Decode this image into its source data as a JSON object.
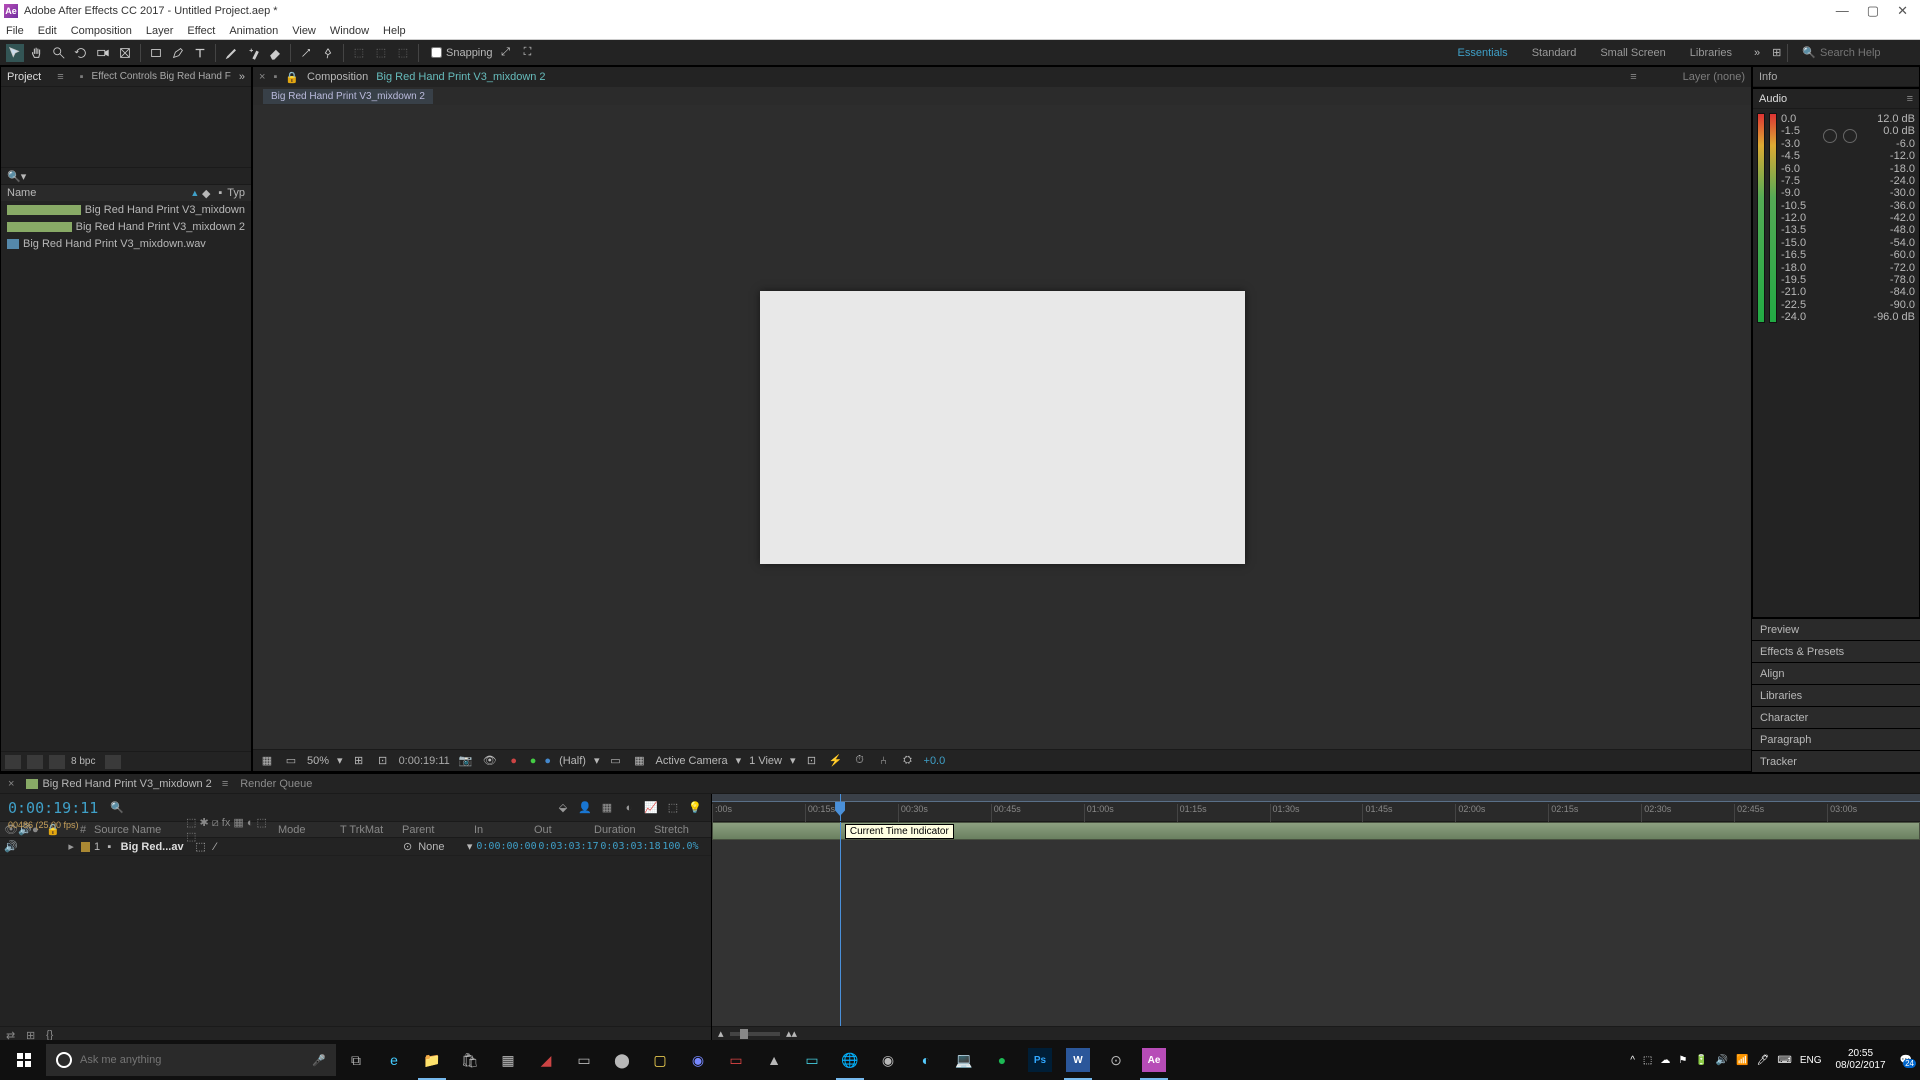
{
  "titlebar": {
    "app": "Ae",
    "title": "Adobe After Effects CC 2017 - Untitled Project.aep *"
  },
  "menubar": [
    "File",
    "Edit",
    "Composition",
    "Layer",
    "Effect",
    "Animation",
    "View",
    "Window",
    "Help"
  ],
  "toolbar": {
    "snapping": "Snapping"
  },
  "workspaces": [
    "Essentials",
    "Standard",
    "Small Screen",
    "Libraries"
  ],
  "search": {
    "placeholder": "Search Help"
  },
  "project": {
    "tab": "Project",
    "effect_controls_tab": "Effect Controls Big Red Hand F",
    "cols": {
      "name": "Name",
      "type": "Typ"
    },
    "items": [
      {
        "name": "Big Red Hand Print V3_mixdown",
        "type": "comp"
      },
      {
        "name": "Big Red Hand Print V3_mixdown 2",
        "type": "comp"
      },
      {
        "name": "Big Red Hand Print V3_mixdown.wav",
        "type": "audio"
      }
    ],
    "bpc": "8 bpc"
  },
  "comp": {
    "tab_label": "Composition",
    "comp_name": "Big Red Hand Print V3_mixdown 2",
    "layer_tab": "Layer (none)",
    "breadcrumb": "Big Red Hand Print V3_mixdown 2",
    "controls": {
      "zoom": "50%",
      "timecode": "0:00:19:11",
      "res": "(Half)",
      "camera": "Active Camera",
      "view": "1 View",
      "exposure": "+0.0"
    }
  },
  "right_panels": {
    "info": "Info",
    "audio": "Audio",
    "db_left": [
      "0.0",
      "-1.5",
      "-3.0",
      "-4.5",
      "-6.0",
      "-7.5",
      "-9.0",
      "-10.5",
      "-12.0",
      "-13.5",
      "-15.0",
      "-16.5",
      "-18.0",
      "-19.5",
      "-21.0",
      "-22.5",
      "-24.0"
    ],
    "db_right": [
      "12.0 dB",
      "0.0 dB",
      "-6.0",
      "-12.0",
      "-18.0",
      "-24.0",
      "-30.0",
      "-36.0",
      "-42.0",
      "-48.0",
      "-54.0",
      "-60.0",
      "-72.0",
      "-78.0",
      "-84.0",
      "-90.0",
      "-96.0 dB"
    ],
    "collapsed": [
      "Preview",
      "Effects & Presets",
      "Align",
      "Libraries",
      "Character",
      "Paragraph",
      "Tracker"
    ]
  },
  "timeline": {
    "tab": "Big Red Hand Print V3_mixdown 2",
    "render_queue": "Render Queue",
    "timecode": "0:00:19:11",
    "frames": "00486 (25.00 fps)",
    "cols": {
      "num": "#",
      "source": "Source Name",
      "mode": "Mode",
      "trkmat": "T  TrkMat",
      "parent": "Parent",
      "in": "In",
      "out": "Out",
      "duration": "Duration",
      "stretch": "Stretch"
    },
    "layer": {
      "num": "1",
      "name": "Big Red...av",
      "parent": "None",
      "in": "0:00:00:00",
      "out": "0:03:03:17",
      "duration": "0:03:03:18",
      "stretch": "100.0%"
    },
    "ticks": [
      ":00s",
      "00:15s",
      "00:30s",
      "00:45s",
      "01:00s",
      "01:15s",
      "01:30s",
      "01:45s",
      "02:00s",
      "02:15s",
      "02:30s",
      "02:45s",
      "03:00s"
    ],
    "tooltip": "Current Time Indicator"
  },
  "taskbar": {
    "cortana": "Ask me anything",
    "lang": "ENG",
    "time": "20:55",
    "date": "08/02/2017",
    "notif": "24"
  }
}
